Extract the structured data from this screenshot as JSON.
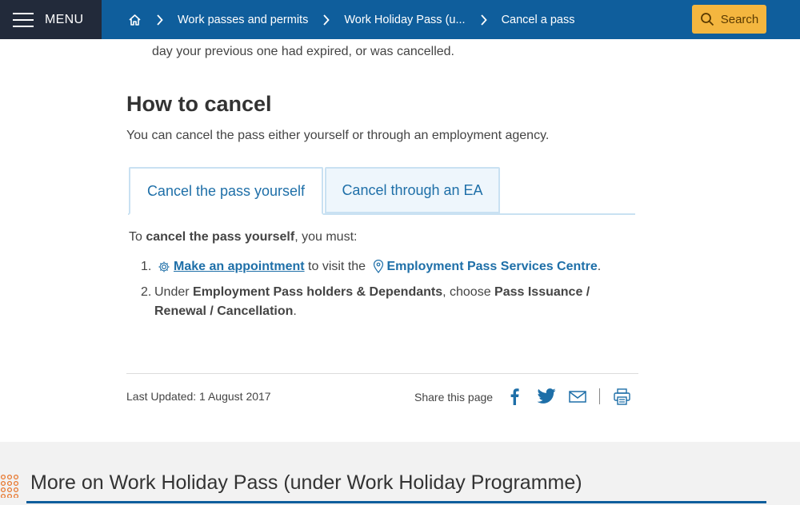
{
  "header": {
    "menu_label": "MENU",
    "breadcrumbs": [
      {
        "label": "Work passes and permits"
      },
      {
        "label": "Work Holiday Pass (u..."
      },
      {
        "label": "Cancel a pass"
      }
    ],
    "search_label": "Search"
  },
  "content": {
    "previous_text": "day your previous one had expired, or was cancelled.",
    "section_title": "How to cancel",
    "intro": "You can cancel the pass either yourself or through an employment agency.",
    "tabs": [
      {
        "label": "Cancel the pass yourself",
        "active": true
      },
      {
        "label": "Cancel through an EA",
        "active": false
      }
    ],
    "must_prefix": "To ",
    "must_bold": "cancel the pass yourself",
    "must_suffix": ", you must:",
    "steps": [
      {
        "number": "1.",
        "link_text": "Make an appointment",
        "middle": " to visit the ",
        "location_text": "Employment Pass Services Centre",
        "end": "."
      },
      {
        "number": "2.",
        "pre": "Under ",
        "bold1": "Employment Pass holders & Dependants",
        "mid": ", choose ",
        "bold2": "Pass Issuance / Renewal / Cancellation",
        "end": "."
      }
    ]
  },
  "footer": {
    "last_updated": "Last Updated: 1 August 2017",
    "share_label": "Share this page"
  },
  "more": {
    "title": "More on Work Holiday Pass (under Work Holiday Programme)"
  },
  "colors": {
    "header_bg": "#0f5e9c",
    "menu_bg": "#222a3a",
    "search_bg": "#f4b63f",
    "link": "#1e6fa8",
    "accent_orange": "#e8772e"
  }
}
